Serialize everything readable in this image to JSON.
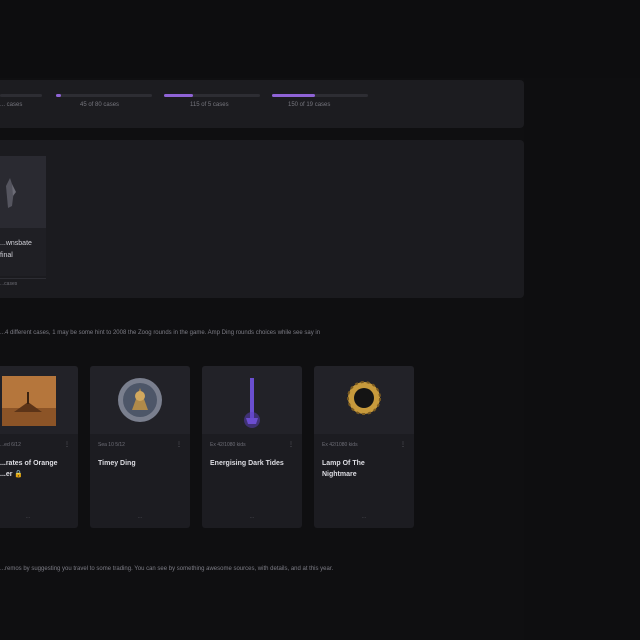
{
  "progress": {
    "items": [
      {
        "label": "... cases",
        "fraction": 0.0
      },
      {
        "label": "45 of 80 cases",
        "fraction": 0.05
      },
      {
        "label": "115 of 5 cases",
        "fraction": 0.3
      },
      {
        "label": "150 of 19 cases",
        "fraction": 0.45
      }
    ]
  },
  "featured": {
    "title": "...wnsbate\nfinal",
    "footer": "...cases"
  },
  "description": "...4 different cases, 1 may be some hint to 2008 the Zoog rounds in the game. Amp Ding rounds choices while see say in",
  "achievements": [
    {
      "meta": "...ed 6/12",
      "name": "...rates of Orange\n...er 🔒",
      "footer": "...",
      "art": "desert-tower"
    },
    {
      "meta": "Sea 10 5/12",
      "name": "Timey Ding",
      "footer": "...",
      "art": "round-emblem"
    },
    {
      "meta": "Ex 42/1080 kids",
      "name": "Energising Dark Tides",
      "footer": "...",
      "art": "purple-spire"
    },
    {
      "meta": "Ex 42/1080 kids",
      "name": "Lamp Of The\nNightmare",
      "footer": "...",
      "art": "dark-ring"
    }
  ],
  "footer_text": "...remos by suggesting you travel to some trading. You can see by something awesome sources, with details, and at this year.",
  "colors": {
    "accent": "#8f63d6",
    "panel": "#1c1c20",
    "background": "#0f0f11"
  }
}
